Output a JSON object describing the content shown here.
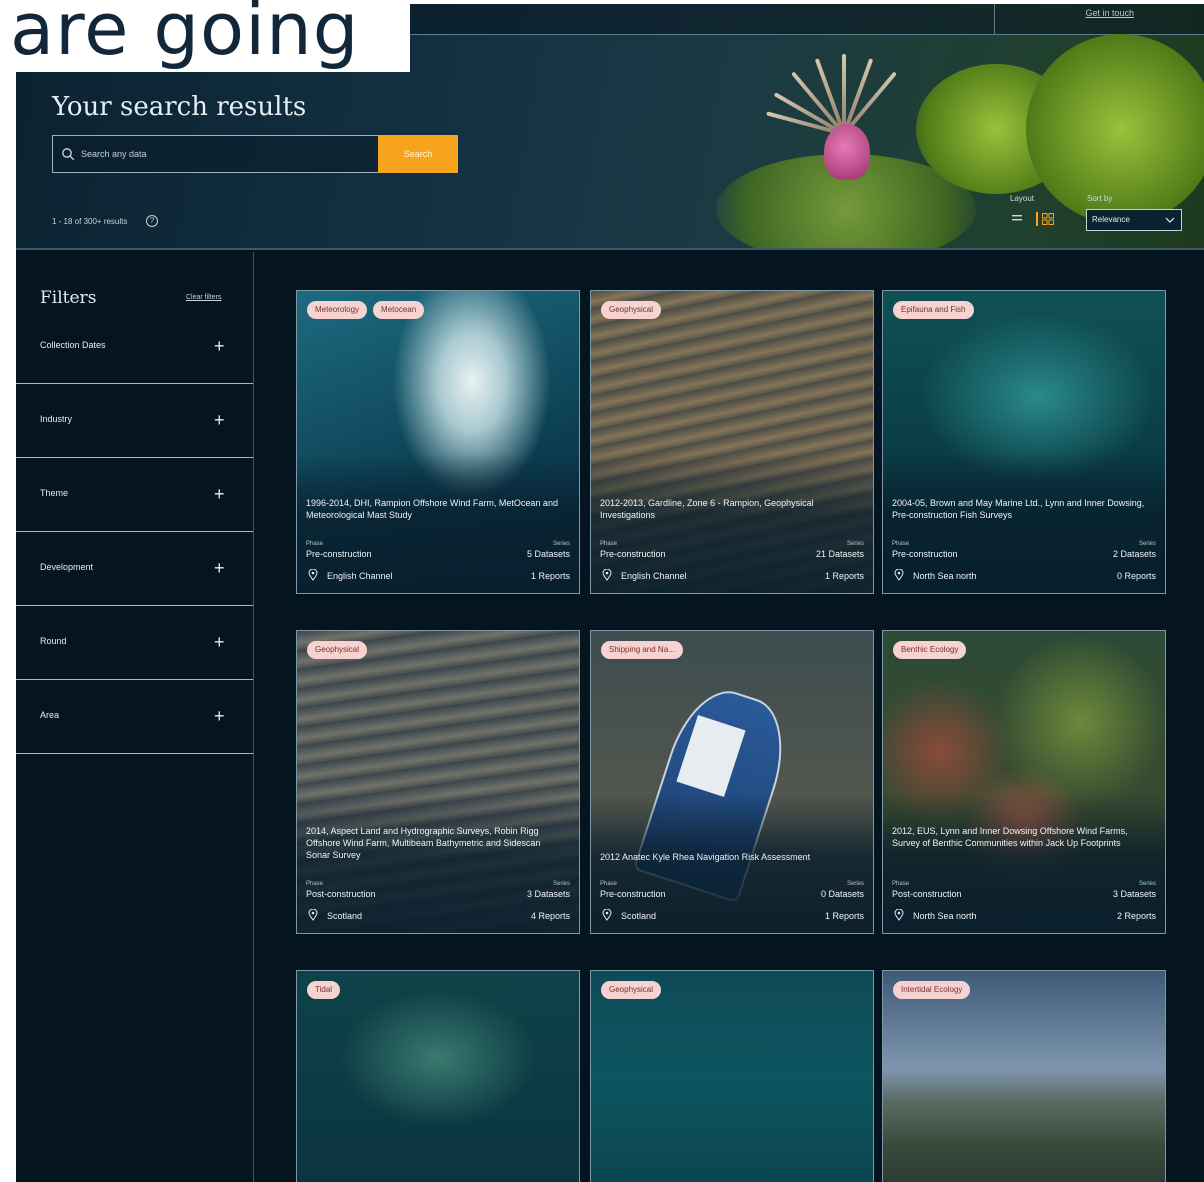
{
  "overlay": {
    "text": "are going"
  },
  "hero": {
    "top_link": "Get in touch",
    "title": "Your search results",
    "search_placeholder": "Search any data",
    "search_button": "Search",
    "results_count": "1 - 18 of 300+ results",
    "layout_label": "Layout",
    "sort_label": "Sort by",
    "sort_value": "Relevance"
  },
  "filters": {
    "title": "Filters",
    "clear_label": "Clear filters",
    "items": [
      {
        "label": "Collection Dates"
      },
      {
        "label": "Industry"
      },
      {
        "label": "Theme"
      },
      {
        "label": "Development"
      },
      {
        "label": "Round"
      },
      {
        "label": "Area"
      }
    ]
  },
  "card_meta": {
    "phase_label": "Phase",
    "series_label": "Series"
  },
  "cards": [
    {
      "tags": [
        "Meteorology",
        "Metocean"
      ],
      "title": "1996-2014, DHI, Rampion Offshore Wind Farm, MetOcean and Meteorological Mast Study",
      "phase": "Pre-construction",
      "datasets": "5 Datasets",
      "location": "English Channel",
      "reports": "1 Reports"
    },
    {
      "tags": [
        "Geophysical"
      ],
      "title": "2012-2013, Gardline, Zone 6 - Rampion, Geophysical Investigations",
      "phase": "Pre-construction",
      "datasets": "21 Datasets",
      "location": "English Channel",
      "reports": "1 Reports"
    },
    {
      "tags": [
        "Epifauna and Fish"
      ],
      "title": "2004-05, Brown and May Marine Ltd., Lynn and Inner Dowsing, Pre-construction Fish Surveys",
      "phase": "Pre-construction",
      "datasets": "2 Datasets",
      "location": "North Sea north",
      "reports": "0 Reports"
    },
    {
      "tags": [
        "Geophysical"
      ],
      "title": "2014, Aspect Land and Hydrographic Surveys, Robin Rigg Offshore Wind Farm, Multibeam Bathymetric and Sidescan Sonar Survey",
      "phase": "Post-construction",
      "datasets": "3 Datasets",
      "location": "Scotland",
      "reports": "4 Reports"
    },
    {
      "tags": [
        "Shipping and Na..."
      ],
      "title": "2012 Anatec Kyle Rhea Navigation Risk Assessment",
      "phase": "Pre-construction",
      "datasets": "0 Datasets",
      "location": "Scotland",
      "reports": "1 Reports"
    },
    {
      "tags": [
        "Benthic Ecology"
      ],
      "title": "2012, EUS, Lynn and Inner Dowsing Offshore Wind Farms, Survey of Benthic Communities within Jack Up Footprints",
      "phase": "Post-construction",
      "datasets": "3 Datasets",
      "location": "North Sea north",
      "reports": "2 Reports"
    },
    {
      "tags": [
        "Tidal"
      ],
      "title": "",
      "phase": "",
      "datasets": "",
      "location": "",
      "reports": ""
    },
    {
      "tags": [
        "Geophysical"
      ],
      "title": "",
      "phase": "",
      "datasets": "",
      "location": "",
      "reports": ""
    },
    {
      "tags": [
        "Intertidal Ecology"
      ],
      "title": "",
      "phase": "",
      "datasets": "",
      "location": "",
      "reports": ""
    }
  ],
  "colors": {
    "accent": "#f6a41e",
    "background": "#051520",
    "tag_bg": "#f6d3d1",
    "tag_text": "#7a2e2a"
  }
}
